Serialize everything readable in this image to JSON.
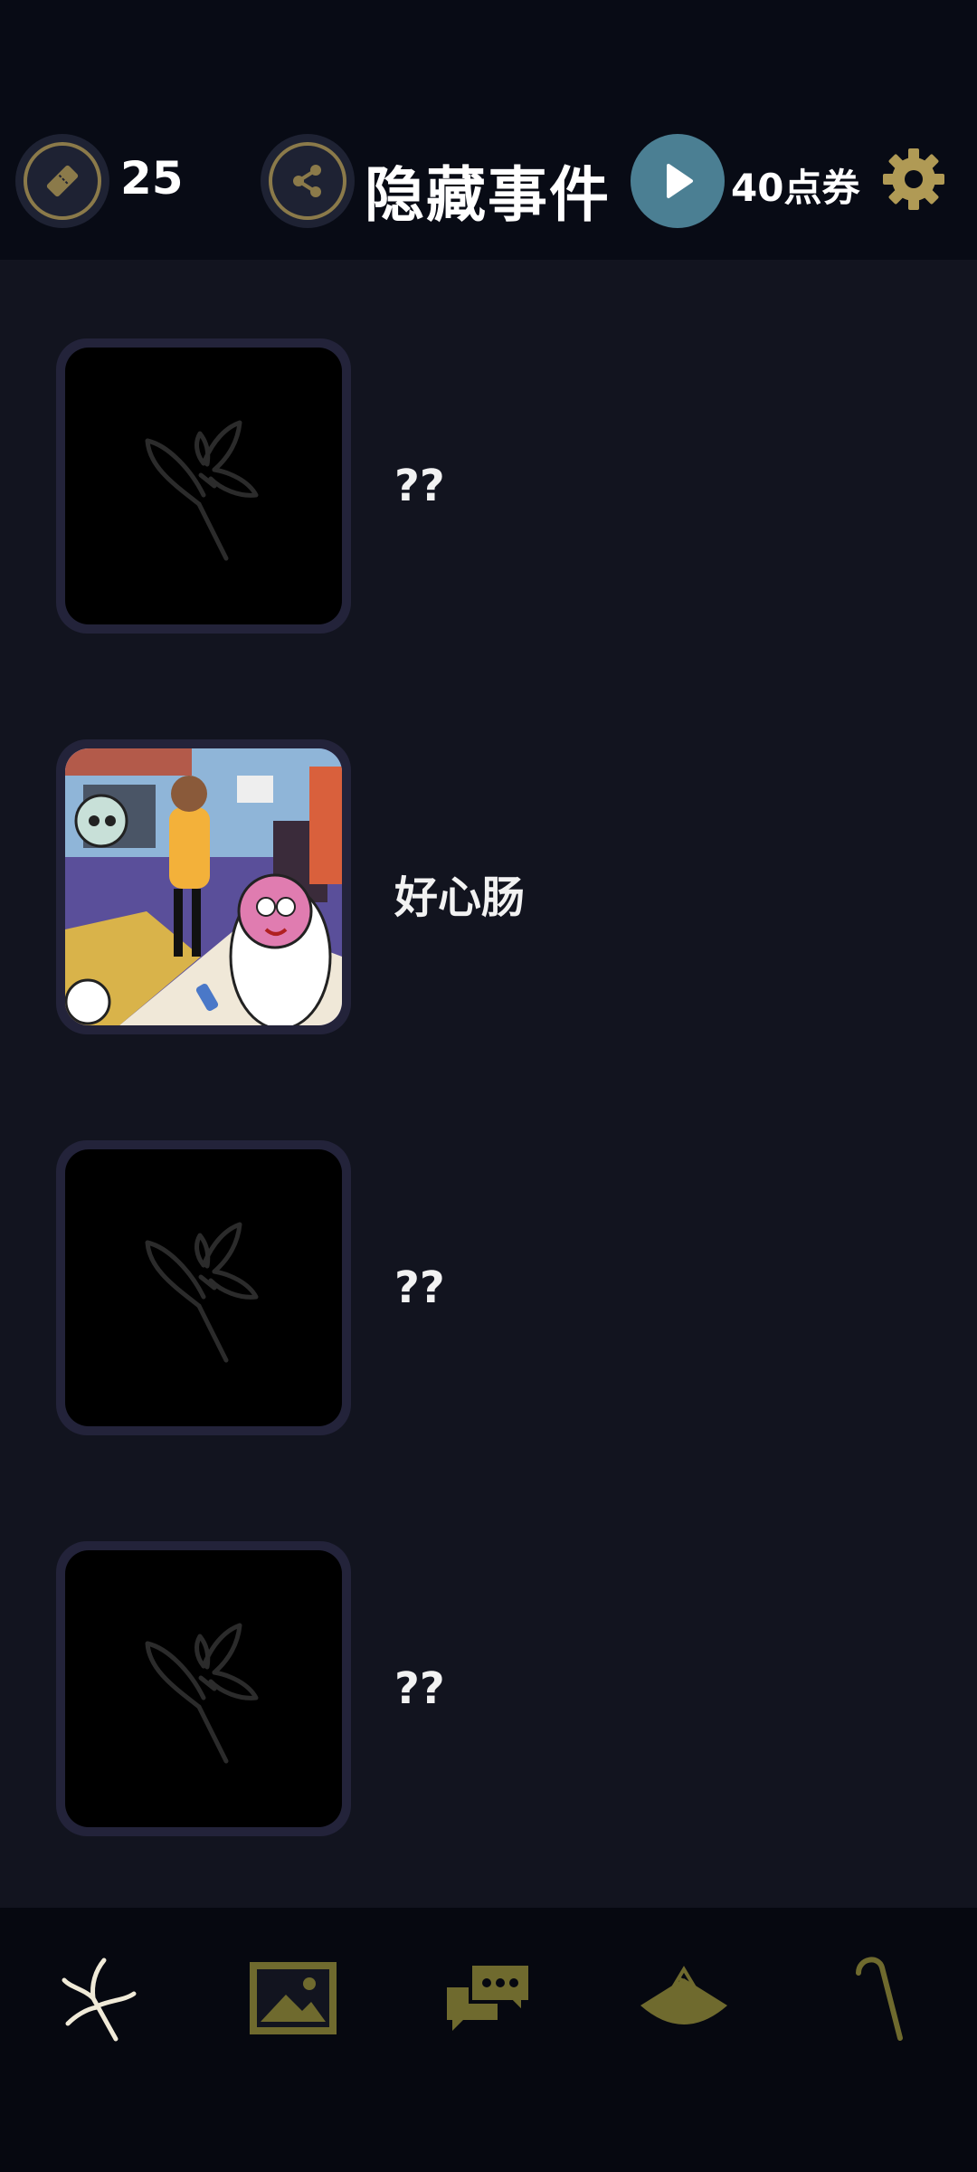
{
  "header": {
    "ticket_count": "25",
    "title": "隐藏事件",
    "coupon_label": "40点券",
    "icons": {
      "ticket": "ticket-icon",
      "share": "share-icon",
      "play": "play-icon",
      "settings": "gear-icon"
    }
  },
  "events": [
    {
      "label": "??",
      "locked": true,
      "thumb": "flower-silhouette"
    },
    {
      "label": "好心肠",
      "locked": false,
      "thumb": "cartoon-scene"
    },
    {
      "label": "??",
      "locked": true,
      "thumb": "flower-silhouette"
    },
    {
      "label": "??",
      "locked": true,
      "thumb": "flower-silhouette"
    }
  ],
  "bottom_nav": [
    {
      "icon": "flower-icon",
      "active": true
    },
    {
      "icon": "gallery-icon",
      "active": false
    },
    {
      "icon": "chat-icon",
      "active": false
    },
    {
      "icon": "hat-icon",
      "active": false
    },
    {
      "icon": "cane-icon",
      "active": false
    }
  ],
  "colors": {
    "background": "#12141f",
    "header": "#080b15",
    "gold": "#8b7a4a",
    "nav_gold": "#6f6a2e",
    "play": "#4b7f93"
  }
}
